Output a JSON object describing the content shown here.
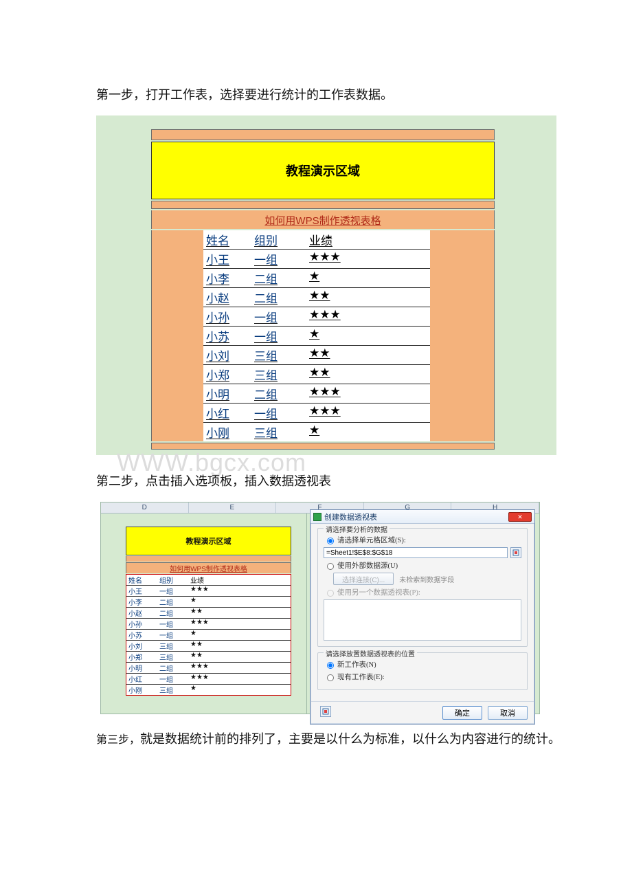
{
  "steps": {
    "s1": "第一步，打开工作表，选择要进行统计的工作表数据。",
    "s2": "第二步，点击插入选项板，插入数据透视表",
    "s3a": "第三步，",
    "s3b": "就是数据统计前的排列了，主要是以什么为标准，以什么为内容进行的统计。"
  },
  "watermark": "WWW.bgcx.com",
  "sheet": {
    "banner": "教程演示区域",
    "title": "如何用WPS制作透视表格",
    "headers": {
      "a": "姓名",
      "b": "组别",
      "c": "业绩"
    },
    "rows": [
      {
        "a": "小王",
        "b": "一组",
        "c": "★★★"
      },
      {
        "a": "小李",
        "b": "二组",
        "c": "★"
      },
      {
        "a": "小赵",
        "b": "二组",
        "c": "★★"
      },
      {
        "a": "小孙",
        "b": "一组",
        "c": "★★★"
      },
      {
        "a": "小苏",
        "b": "一组",
        "c": "★"
      },
      {
        "a": "小刘",
        "b": "三组",
        "c": "★★"
      },
      {
        "a": "小郑",
        "b": "三组",
        "c": "★★"
      },
      {
        "a": "小明",
        "b": "二组",
        "c": "★★★"
      },
      {
        "a": "小红",
        "b": "一组",
        "c": "★★★"
      },
      {
        "a": "小刚",
        "b": "三组",
        "c": "★"
      }
    ]
  },
  "colheaders": [
    "D",
    "E",
    "F",
    "G",
    "H"
  ],
  "dialog": {
    "title": "创建数据透视表",
    "close": "✕",
    "group1": "请选择要分析的数据",
    "opt_range": "请选择单元格区域(S):",
    "range_value": "=Sheet1!$E$8:$G$18",
    "opt_ext": "使用外部数据源(U)",
    "btn_conn": "选择连接(C)...",
    "conn_note": "未检索到数据字段",
    "opt_another": "使用另一个数据透视表(P):",
    "group2": "请选择放置数据透视表的位置",
    "opt_new": "新工作表(N)",
    "opt_exist": "现有工作表(E):",
    "ok": "确定",
    "cancel": "取消"
  }
}
